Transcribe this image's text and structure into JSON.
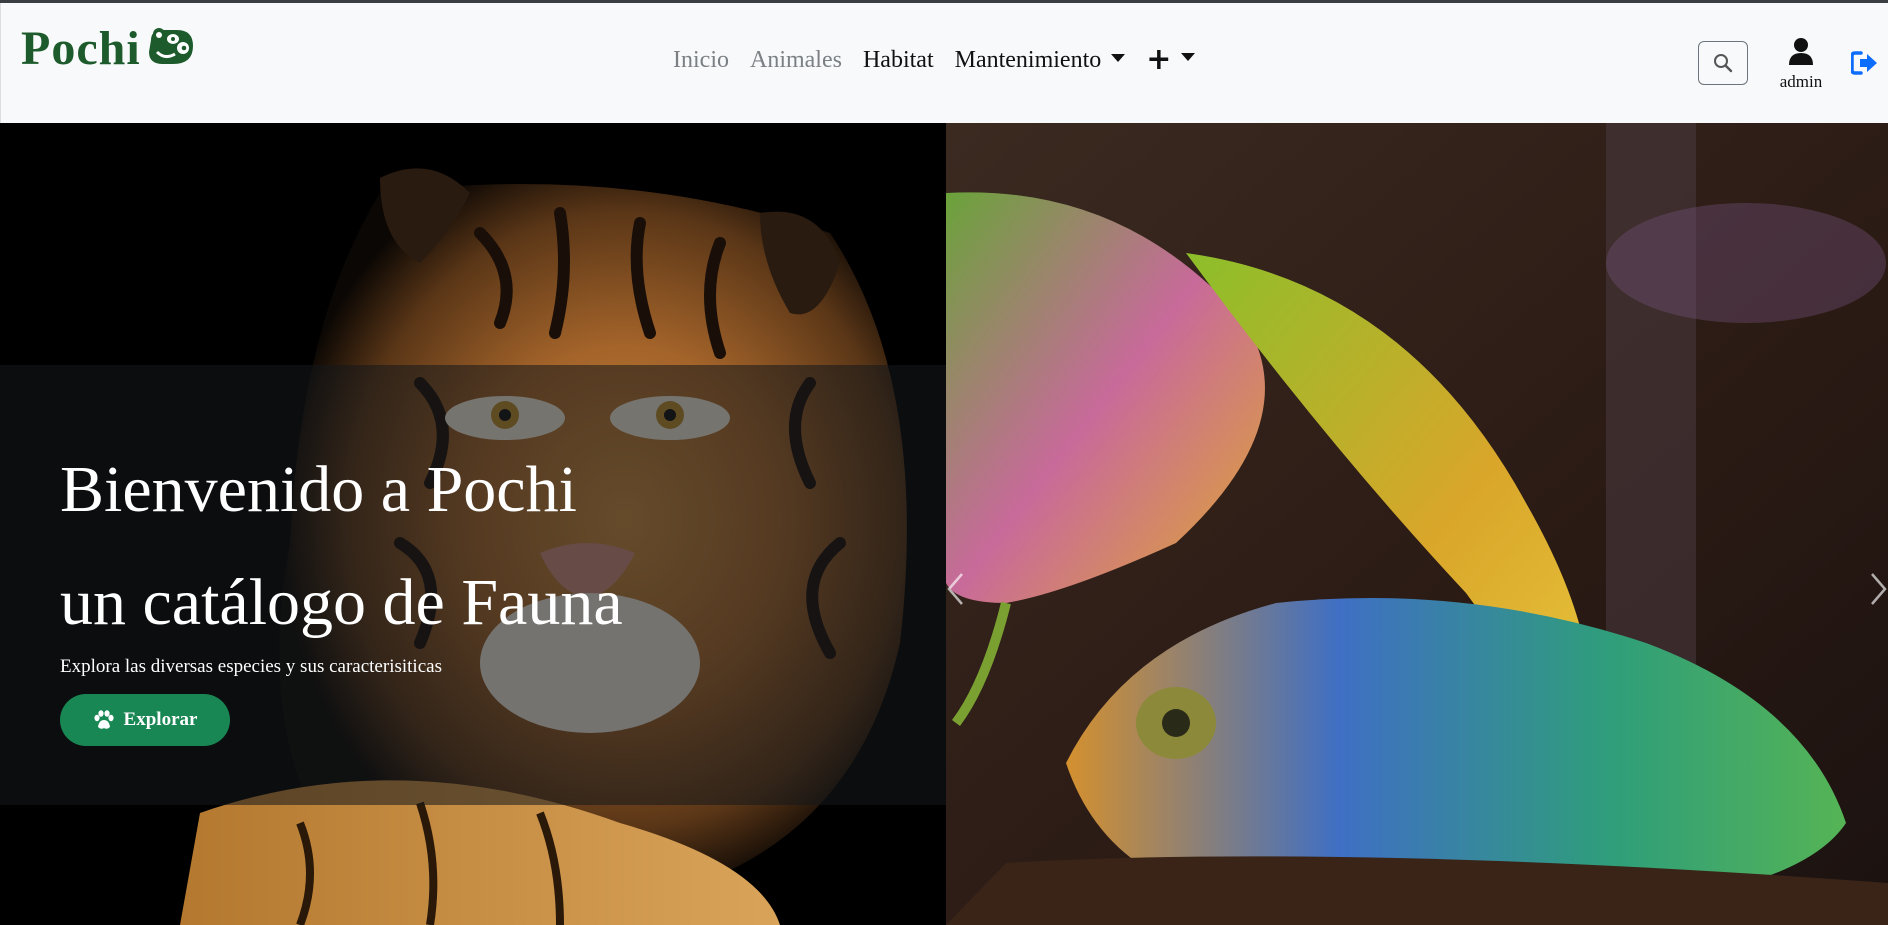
{
  "brand": {
    "name": "Pochi",
    "color": "#1d5b2c"
  },
  "nav": {
    "links": [
      {
        "label": "Inicio",
        "active": false
      },
      {
        "label": "Animales",
        "active": false
      },
      {
        "label": "Habitat",
        "active": true
      },
      {
        "label": "Mantenimiento",
        "dropdown": true
      }
    ],
    "plus_dropdown": {
      "icon": "plus-icon",
      "dropdown": true
    }
  },
  "search": {
    "icon": "search-icon"
  },
  "user": {
    "icon": "user-icon",
    "name": "admin"
  },
  "logout": {
    "icon": "sign-out-icon",
    "color": "#0d6efd"
  },
  "hero": {
    "title_line1": "Bienvenido a Pochi",
    "title_line2": "un catálogo de Fauna",
    "subtitle": "Explora las diversas especies y sus caracterisiticas",
    "button_label": "Explorar",
    "button_icon": "paw-icon",
    "button_color": "#198754",
    "slides": [
      "tiger-image",
      "chameleon-image"
    ]
  }
}
